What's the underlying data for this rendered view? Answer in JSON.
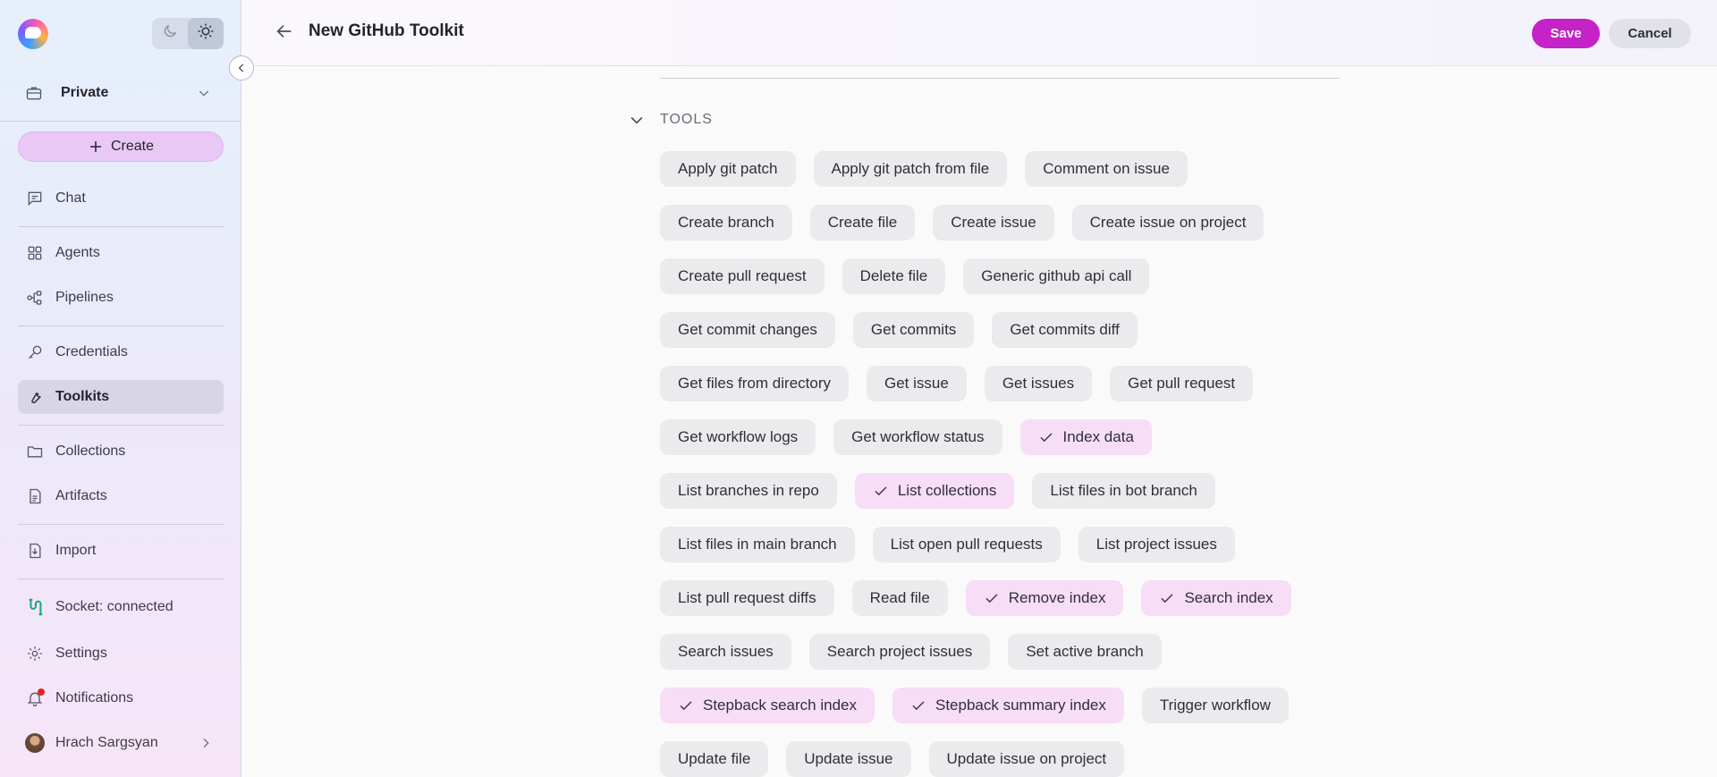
{
  "sidebar": {
    "workspace": "Private",
    "create_label": "Create",
    "nav": {
      "chat": "Chat",
      "agents": "Agents",
      "pipelines": "Pipelines",
      "credentials": "Credentials",
      "toolkits": "Toolkits",
      "collections": "Collections",
      "artifacts": "Artifacts",
      "import": "Import",
      "socket": "Socket: connected",
      "settings": "Settings",
      "notifications": "Notifications",
      "user": "Hrach Sargsyan"
    }
  },
  "header": {
    "title": "New GitHub Toolkit",
    "save_label": "Save",
    "cancel_label": "Cancel"
  },
  "tools_section": {
    "label": "TOOLS",
    "rows": [
      [
        {
          "label": "Apply git patch",
          "selected": false
        },
        {
          "label": "Apply git patch from file",
          "selected": false
        },
        {
          "label": "Comment on issue",
          "selected": false
        }
      ],
      [
        {
          "label": "Create branch",
          "selected": false
        },
        {
          "label": "Create file",
          "selected": false
        },
        {
          "label": "Create issue",
          "selected": false
        },
        {
          "label": "Create issue on project",
          "selected": false
        }
      ],
      [
        {
          "label": "Create pull request",
          "selected": false
        },
        {
          "label": "Delete file",
          "selected": false
        },
        {
          "label": "Generic github api call",
          "selected": false
        }
      ],
      [
        {
          "label": "Get commit changes",
          "selected": false
        },
        {
          "label": "Get commits",
          "selected": false
        },
        {
          "label": "Get commits diff",
          "selected": false
        }
      ],
      [
        {
          "label": "Get files from directory",
          "selected": false
        },
        {
          "label": "Get issue",
          "selected": false
        },
        {
          "label": "Get issues",
          "selected": false
        },
        {
          "label": "Get pull request",
          "selected": false
        }
      ],
      [
        {
          "label": "Get workflow logs",
          "selected": false
        },
        {
          "label": "Get workflow status",
          "selected": false
        },
        {
          "label": "Index data",
          "selected": true
        }
      ],
      [
        {
          "label": "List branches in repo",
          "selected": false
        },
        {
          "label": "List collections",
          "selected": true
        },
        {
          "label": "List files in bot branch",
          "selected": false
        }
      ],
      [
        {
          "label": "List files in main branch",
          "selected": false
        },
        {
          "label": "List open pull requests",
          "selected": false
        },
        {
          "label": "List project issues",
          "selected": false
        }
      ],
      [
        {
          "label": "List pull request diffs",
          "selected": false
        },
        {
          "label": "Read file",
          "selected": false
        },
        {
          "label": "Remove index",
          "selected": true
        },
        {
          "label": "Search index",
          "selected": true
        }
      ],
      [
        {
          "label": "Search issues",
          "selected": false
        },
        {
          "label": "Search project issues",
          "selected": false
        },
        {
          "label": "Set active branch",
          "selected": false
        }
      ],
      [
        {
          "label": "Stepback search index",
          "selected": true
        },
        {
          "label": "Stepback summary index",
          "selected": true
        },
        {
          "label": "Trigger workflow",
          "selected": false
        }
      ],
      [
        {
          "label": "Update file",
          "selected": false
        },
        {
          "label": "Update issue",
          "selected": false
        },
        {
          "label": "Update issue on project",
          "selected": false
        }
      ]
    ]
  },
  "colors": {
    "accent": "#c522c8",
    "chip_bg": "#ebebee",
    "chip_selected_bg": "#f7ddf5",
    "socket_status": "#1aa67a",
    "notification_dot": "#e02424"
  }
}
